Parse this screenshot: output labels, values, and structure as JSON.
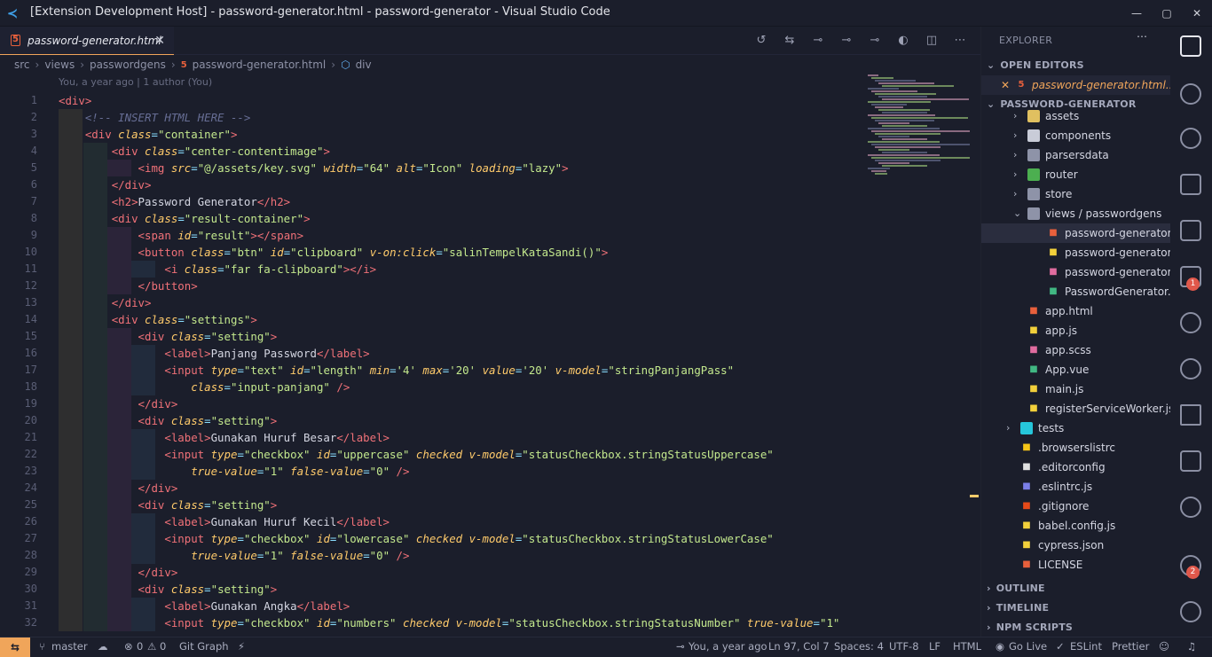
{
  "window": {
    "title": "[Extension Development Host] - password-generator.html - password-generator - Visual Studio Code",
    "controls": [
      "—",
      "▢",
      "✕"
    ]
  },
  "tab": {
    "label": "password-generator.html",
    "icon": "html5-icon"
  },
  "breadcrumb": [
    "src",
    "views",
    "passwordgens",
    "password-generator.html",
    "div"
  ],
  "blame": "You, a year ago | 1 author (You)",
  "code": [
    {
      "n": "1",
      "html": "<span class=\"t\">&lt;div&gt;</span>",
      "ind": 0
    },
    {
      "n": "2",
      "html": "    <span class=\"c\">&lt;!-- INSERT HTML HERE --&gt;</span>",
      "ind": 1
    },
    {
      "n": "3",
      "html": "    <span class=\"t\">&lt;div</span> <span class=\"a\">class</span><span class=\"p\">=</span><span class=\"s\">\"container\"</span><span class=\"t\">&gt;</span>",
      "ind": 1
    },
    {
      "n": "4",
      "html": "        <span class=\"t\">&lt;div</span> <span class=\"a\">class</span><span class=\"p\">=</span><span class=\"s\">\"center-contentimage\"</span><span class=\"t\">&gt;</span>",
      "ind": 2
    },
    {
      "n": "5",
      "html": "            <span class=\"t\">&lt;img</span> <span class=\"a\">src</span><span class=\"p\">=</span><span class=\"s\">\"@/assets/key.svg\"</span> <span class=\"a\">width</span><span class=\"p\">=</span><span class=\"s\">\"64\"</span> <span class=\"a\">alt</span><span class=\"p\">=</span><span class=\"s\">\"Icon\"</span> <span class=\"a\">loading</span><span class=\"p\">=</span><span class=\"s\">\"lazy\"</span><span class=\"t\">&gt;</span>",
      "ind": 3
    },
    {
      "n": "6",
      "html": "        <span class=\"t\">&lt;/div&gt;</span>",
      "ind": 2
    },
    {
      "n": "7",
      "html": "        <span class=\"t\">&lt;h2&gt;</span>Password Generator<span class=\"t\">&lt;/h2&gt;</span>",
      "ind": 2
    },
    {
      "n": "8",
      "html": "        <span class=\"t\">&lt;div</span> <span class=\"a\">class</span><span class=\"p\">=</span><span class=\"s\">\"result-container\"</span><span class=\"t\">&gt;</span>",
      "ind": 2
    },
    {
      "n": "9",
      "html": "            <span class=\"t\">&lt;span</span> <span class=\"a\">id</span><span class=\"p\">=</span><span class=\"s\">\"result\"</span><span class=\"t\">&gt;&lt;/span&gt;</span>",
      "ind": 3
    },
    {
      "n": "10",
      "html": "            <span class=\"t\">&lt;button</span> <span class=\"a\">class</span><span class=\"p\">=</span><span class=\"s\">\"btn\"</span> <span class=\"a\">id</span><span class=\"p\">=</span><span class=\"s\">\"clipboard\"</span> <span class=\"a\">v-on:click</span><span class=\"p\">=</span><span class=\"s\">\"salinTempelKataSandi()\"</span><span class=\"t\">&gt;</span>",
      "ind": 3
    },
    {
      "n": "11",
      "html": "                <span class=\"t\">&lt;i</span> <span class=\"a\">class</span><span class=\"p\">=</span><span class=\"s\">\"far fa-clipboard\"</span><span class=\"t\">&gt;&lt;/i&gt;</span>",
      "ind": 4
    },
    {
      "n": "12",
      "html": "            <span class=\"t\">&lt;/button&gt;</span>",
      "ind": 3
    },
    {
      "n": "13",
      "html": "        <span class=\"t\">&lt;/div&gt;</span>",
      "ind": 2
    },
    {
      "n": "14",
      "html": "        <span class=\"t\">&lt;div</span> <span class=\"a\">class</span><span class=\"p\">=</span><span class=\"s\">\"settings\"</span><span class=\"t\">&gt;</span>",
      "ind": 2
    },
    {
      "n": "15",
      "html": "            <span class=\"t\">&lt;div</span> <span class=\"a\">class</span><span class=\"p\">=</span><span class=\"s\">\"setting\"</span><span class=\"t\">&gt;</span>",
      "ind": 3
    },
    {
      "n": "16",
      "html": "                <span class=\"t\">&lt;label&gt;</span>Panjang Password<span class=\"t\">&lt;/label&gt;</span>",
      "ind": 4
    },
    {
      "n": "17",
      "html": "                <span class=\"t\">&lt;input</span> <span class=\"a\">type</span><span class=\"p\">=</span><span class=\"s\">\"text\"</span> <span class=\"a\">id</span><span class=\"p\">=</span><span class=\"s\">\"length\"</span> <span class=\"a\">min</span><span class=\"p\">=</span><span class=\"s\">'4'</span> <span class=\"a\">max</span><span class=\"p\">=</span><span class=\"s\">'20'</span> <span class=\"a\">value</span><span class=\"p\">=</span><span class=\"s\">'20'</span> <span class=\"a\">v-model</span><span class=\"p\">=</span><span class=\"s\">\"stringPanjangPass\"</span>",
      "ind": 4
    },
    {
      "n": "18",
      "html": "                    <span class=\"a\">class</span><span class=\"p\">=</span><span class=\"s\">\"input-panjang\"</span> <span class=\"t\">/&gt;</span>",
      "ind": 4
    },
    {
      "n": "19",
      "html": "            <span class=\"t\">&lt;/div&gt;</span>",
      "ind": 3
    },
    {
      "n": "20",
      "html": "            <span class=\"t\">&lt;div</span> <span class=\"a\">class</span><span class=\"p\">=</span><span class=\"s\">\"setting\"</span><span class=\"t\">&gt;</span>",
      "ind": 3
    },
    {
      "n": "21",
      "html": "                <span class=\"t\">&lt;label&gt;</span>Gunakan Huruf Besar<span class=\"t\">&lt;/label&gt;</span>",
      "ind": 4
    },
    {
      "n": "22",
      "html": "                <span class=\"t\">&lt;input</span> <span class=\"a\">type</span><span class=\"p\">=</span><span class=\"s\">\"checkbox\"</span> <span class=\"a\">id</span><span class=\"p\">=</span><span class=\"s\">\"uppercase\"</span> <span class=\"a\">checked</span> <span class=\"a\">v-model</span><span class=\"p\">=</span><span class=\"s\">\"statusCheckbox.stringStatusUppercase\"</span>",
      "ind": 4
    },
    {
      "n": "23",
      "html": "                    <span class=\"a\">true-value</span><span class=\"p\">=</span><span class=\"s\">\"1\"</span> <span class=\"a\">false-value</span><span class=\"p\">=</span><span class=\"s\">\"0\"</span> <span class=\"t\">/&gt;</span>",
      "ind": 4
    },
    {
      "n": "24",
      "html": "            <span class=\"t\">&lt;/div&gt;</span>",
      "ind": 3
    },
    {
      "n": "25",
      "html": "            <span class=\"t\">&lt;div</span> <span class=\"a\">class</span><span class=\"p\">=</span><span class=\"s\">\"setting\"</span><span class=\"t\">&gt;</span>",
      "ind": 3
    },
    {
      "n": "26",
      "html": "                <span class=\"t\">&lt;label&gt;</span>Gunakan Huruf Kecil<span class=\"t\">&lt;/label&gt;</span>",
      "ind": 4
    },
    {
      "n": "27",
      "html": "                <span class=\"t\">&lt;input</span> <span class=\"a\">type</span><span class=\"p\">=</span><span class=\"s\">\"checkbox\"</span> <span class=\"a\">id</span><span class=\"p\">=</span><span class=\"s\">\"lowercase\"</span> <span class=\"a\">checked</span> <span class=\"a\">v-model</span><span class=\"p\">=</span><span class=\"s\">\"statusCheckbox.stringStatusLowerCase\"</span>",
      "ind": 4
    },
    {
      "n": "28",
      "html": "                    <span class=\"a\">true-value</span><span class=\"p\">=</span><span class=\"s\">\"1\"</span> <span class=\"a\">false-value</span><span class=\"p\">=</span><span class=\"s\">\"0\"</span> <span class=\"t\">/&gt;</span>",
      "ind": 4
    },
    {
      "n": "29",
      "html": "            <span class=\"t\">&lt;/div&gt;</span>",
      "ind": 3
    },
    {
      "n": "30",
      "html": "            <span class=\"t\">&lt;div</span> <span class=\"a\">class</span><span class=\"p\">=</span><span class=\"s\">\"setting\"</span><span class=\"t\">&gt;</span>",
      "ind": 3
    },
    {
      "n": "31",
      "html": "                <span class=\"t\">&lt;label&gt;</span>Gunakan Angka<span class=\"t\">&lt;/label&gt;</span>",
      "ind": 4
    },
    {
      "n": "32",
      "html": "                <span class=\"t\">&lt;input</span> <span class=\"a\">type</span><span class=\"p\">=</span><span class=\"s\">\"checkbox\"</span> <span class=\"a\">id</span><span class=\"p\">=</span><span class=\"s\">\"numbers\"</span> <span class=\"a\">checked</span> <span class=\"a\">v-model</span><span class=\"p\">=</span><span class=\"s\">\"statusCheckbox.stringStatusNumber\"</span> <span class=\"a\">true-value</span><span class=\"p\">=</span><span class=\"s\">\"1\"</span>",
      "ind": 4
    }
  ],
  "explorer": {
    "title": "EXPLORER",
    "open_editors": "OPEN EDITORS",
    "open_file": "password-generator.html...",
    "project": "PASSWORD-GENERATOR",
    "tree": [
      {
        "label": "assets",
        "icon": "folder-icon",
        "depth": 1,
        "chev": "›",
        "color": "#e0c060"
      },
      {
        "label": "components",
        "icon": "folder-icon",
        "depth": 1,
        "chev": "›",
        "color": "#c9ccd8"
      },
      {
        "label": "parsersdata",
        "icon": "folder-icon",
        "depth": 1,
        "chev": "›",
        "color": "#8e93a8"
      },
      {
        "label": "router",
        "icon": "folder-router-icon",
        "depth": 1,
        "chev": "›",
        "color": "#4caf50"
      },
      {
        "label": "store",
        "icon": "folder-icon",
        "depth": 1,
        "chev": "›",
        "color": "#8e93a8"
      },
      {
        "label": "views / passwordgens",
        "icon": "folder-open-icon",
        "depth": 1,
        "chev": "⌄",
        "color": "#8e93a8"
      },
      {
        "label": "password-generator.html",
        "icon": "html5-icon",
        "depth": 2,
        "chev": "",
        "color": "#e8603c",
        "selected": true
      },
      {
        "label": "password-generator.js",
        "icon": "js-icon",
        "depth": 2,
        "chev": "",
        "color": "#f2d03b"
      },
      {
        "label": "password-generator.scss",
        "icon": "sass-icon",
        "depth": 2,
        "chev": "",
        "color": "#e06c9f"
      },
      {
        "label": "PasswordGenerator.vue",
        "icon": "vue-icon",
        "depth": 2,
        "chev": "",
        "color": "#41b883"
      },
      {
        "label": "app.html",
        "icon": "html5-icon",
        "depth": 1,
        "chev": "",
        "color": "#e8603c"
      },
      {
        "label": "app.js",
        "icon": "js-icon",
        "depth": 1,
        "chev": "",
        "color": "#f2d03b"
      },
      {
        "label": "app.scss",
        "icon": "sass-icon",
        "depth": 1,
        "chev": "",
        "color": "#e06c9f"
      },
      {
        "label": "App.vue",
        "icon": "vue-icon",
        "depth": 1,
        "chev": "",
        "color": "#41b883"
      },
      {
        "label": "main.js",
        "icon": "js-icon",
        "depth": 1,
        "chev": "",
        "color": "#f2d03b"
      },
      {
        "label": "registerServiceWorker.js",
        "icon": "js-icon",
        "depth": 1,
        "chev": "",
        "color": "#f2d03b"
      },
      {
        "label": "tests",
        "icon": "folder-test-icon",
        "depth": 0,
        "chev": "›",
        "color": "#26c6da"
      },
      {
        "label": ".browserslistrc",
        "icon": "browserslist-icon",
        "depth": 0,
        "chev": "",
        "color": "#f5c518"
      },
      {
        "label": ".editorconfig",
        "icon": "editorconfig-icon",
        "depth": 0,
        "chev": "",
        "color": "#e0e0e0"
      },
      {
        "label": ".eslintrc.js",
        "icon": "eslint-icon",
        "depth": 0,
        "chev": "",
        "color": "#7b7fe8"
      },
      {
        "label": ".gitignore",
        "icon": "git-icon",
        "depth": 0,
        "chev": "",
        "color": "#e64a19"
      },
      {
        "label": "babel.config.js",
        "icon": "babel-icon",
        "depth": 0,
        "chev": "",
        "color": "#f2d03b"
      },
      {
        "label": "cypress.json",
        "icon": "json-icon",
        "depth": 0,
        "chev": "",
        "color": "#f2d03b"
      },
      {
        "label": "LICENSE",
        "icon": "license-icon",
        "depth": 0,
        "chev": "",
        "color": "#e8603c"
      }
    ],
    "outline": "OUTLINE",
    "timeline": "TIMELINE",
    "npm": "NPM SCRIPTS"
  },
  "activity_badges": {
    "extensions": "1",
    "accounts": "2"
  },
  "status": {
    "branch": "master",
    "errors": "0",
    "warnings": "0",
    "gitgraph": "Git Graph",
    "blame": "You, a year ago",
    "position": "Ln 97, Col 7",
    "spaces": "Spaces: 4",
    "encoding": "UTF-8",
    "eol": "LF",
    "language": "HTML",
    "golive": "Go Live",
    "eslint": "ESLint",
    "prettier": "Prettier"
  }
}
